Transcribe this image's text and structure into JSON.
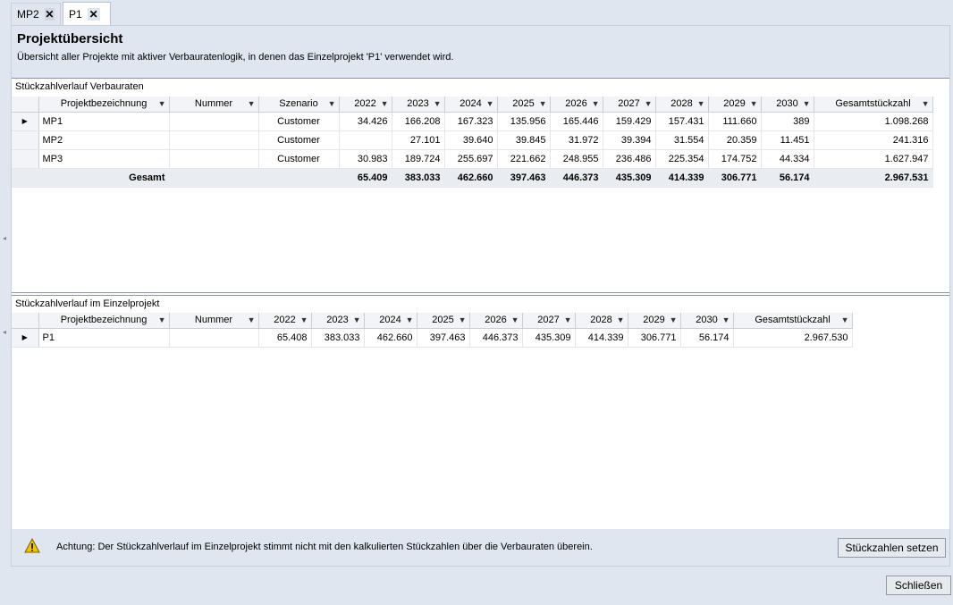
{
  "tabs": [
    {
      "label": "MP2",
      "active": false
    },
    {
      "label": "P1",
      "active": true
    }
  ],
  "page": {
    "title": "Projektübersicht",
    "subtitle": "Übersicht aller Projekte mit aktiver Verbauratenlogik, in denen das Einzelprojekt 'P1' verwendet wird."
  },
  "upper": {
    "title": "Stückzahlverlauf Verbauraten",
    "columns": [
      "Projektbezeichnung",
      "Nummer",
      "Szenario",
      "2022",
      "2023",
      "2024",
      "2025",
      "2026",
      "2027",
      "2028",
      "2029",
      "2030",
      "Gesamtstückzahl"
    ],
    "rows": [
      {
        "name": "MP1",
        "nummer": "",
        "szenario": "Customer",
        "values": [
          "34.426",
          "166.208",
          "167.323",
          "135.956",
          "165.446",
          "159.429",
          "157.431",
          "111.660",
          "389"
        ],
        "total": "1.098.268"
      },
      {
        "name": "MP2",
        "nummer": "",
        "szenario": "Customer",
        "values": [
          "",
          "27.101",
          "39.640",
          "39.845",
          "31.972",
          "39.394",
          "31.554",
          "20.359",
          "11.451"
        ],
        "total": "241.316"
      },
      {
        "name": "MP3",
        "nummer": "",
        "szenario": "Customer",
        "values": [
          "30.983",
          "189.724",
          "255.697",
          "221.662",
          "248.955",
          "236.486",
          "225.354",
          "174.752",
          "44.334"
        ],
        "total": "1.627.947"
      }
    ],
    "total_row": {
      "label": "Gesamt",
      "values": [
        "65.409",
        "383.033",
        "462.660",
        "397.463",
        "446.373",
        "435.309",
        "414.339",
        "306.771",
        "56.174"
      ],
      "total": "2.967.531"
    }
  },
  "lower": {
    "title": "Stückzahlverlauf im Einzelprojekt",
    "columns": [
      "Projektbezeichnung",
      "Nummer",
      "2022",
      "2023",
      "2024",
      "2025",
      "2026",
      "2027",
      "2028",
      "2029",
      "2030",
      "Gesamtstückzahl"
    ],
    "rows": [
      {
        "name": "P1",
        "nummer": "",
        "values": [
          "65.408",
          "383.033",
          "462.660",
          "397.463",
          "446.373",
          "435.309",
          "414.339",
          "306.771",
          "56.174"
        ],
        "total": "2.967.530"
      }
    ]
  },
  "warning": {
    "text": "Achtung: Der Stückzahlverlauf im Einzelprojekt stimmt nicht mit den kalkulierten Stückzahlen über die Verbauraten überein.",
    "icon": "warning-icon",
    "color": "#f2c200"
  },
  "buttons": {
    "set": "Stückzahlen setzen",
    "close": "Schließen"
  },
  "icons": {
    "filter": "▼",
    "row_pointer": "▶",
    "close_tab": "✕"
  }
}
